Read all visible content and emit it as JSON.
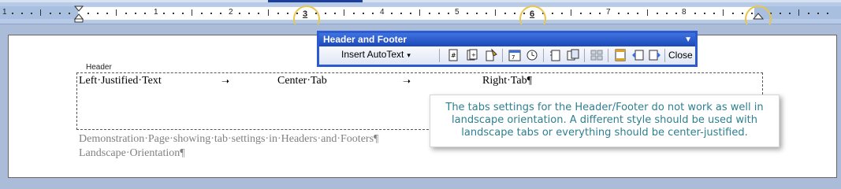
{
  "ruler": {
    "numbers": [
      "1",
      "1",
      "2",
      "3",
      "4",
      "5",
      "6",
      "7",
      "8",
      "9"
    ],
    "tab_markers": [
      "3",
      "6"
    ]
  },
  "toolbar": {
    "title": "Header and Footer",
    "insert_autotext_label": "Insert AutoText",
    "close_label": "Close",
    "icons": [
      "insert-page-number-icon",
      "insert-number-of-pages-icon",
      "format-page-number-icon",
      "insert-date-icon",
      "insert-time-icon",
      "page-setup-icon",
      "show-hide-document-text-icon",
      "same-as-previous-icon",
      "switch-header-footer-icon",
      "show-previous-icon",
      "show-next-icon"
    ]
  },
  "document": {
    "header_tag": "Header",
    "header_line": {
      "left": "Left·Justified·Text",
      "center": "Center·Tab",
      "right": "Right·Tab¶"
    },
    "body_lines": [
      "Demonstration·Page·showing·tab·settings·in·Headers·and·Footers¶",
      "Landscape·Orientation¶"
    ]
  },
  "callout": {
    "text": "The tabs settings for the Header/Footer do not work as well in landscape orientation. A different style should be used with landscape tabs or everything should be center-justified."
  },
  "colors": {
    "highlight": "#e8c54b",
    "toolbar_title": "#2c5bd1",
    "callout_text": "#2e7f8f"
  }
}
